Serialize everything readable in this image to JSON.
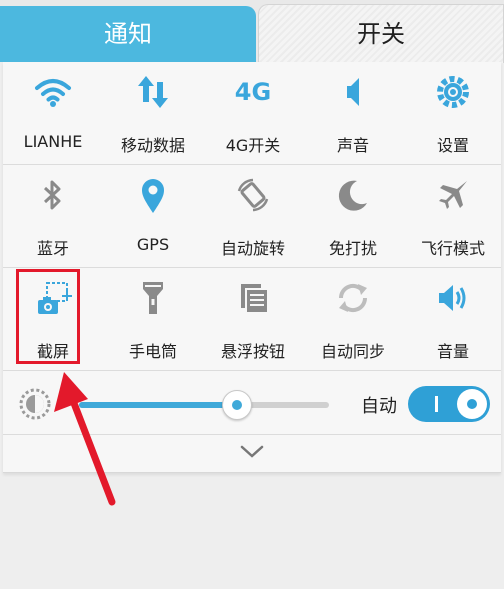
{
  "tabs": {
    "notifications": "通知",
    "switches": "开关"
  },
  "tiles": {
    "row1": [
      {
        "label": "LIANHE",
        "icon": "wifi-icon"
      },
      {
        "label": "移动数据",
        "icon": "mobile-data-icon"
      },
      {
        "label": "4G开关",
        "icon": "4g-icon",
        "icon_text": "4G"
      },
      {
        "label": "声音",
        "icon": "speaker-icon"
      },
      {
        "label": "设置",
        "icon": "gear-icon"
      }
    ],
    "row2": [
      {
        "label": "蓝牙",
        "icon": "bluetooth-icon"
      },
      {
        "label": "GPS",
        "icon": "location-pin-icon"
      },
      {
        "label": "自动旋转",
        "icon": "auto-rotate-icon"
      },
      {
        "label": "免打扰",
        "icon": "moon-icon"
      },
      {
        "label": "飞行模式",
        "icon": "airplane-icon"
      }
    ],
    "row3": [
      {
        "label": "截屏",
        "icon": "screenshot-icon"
      },
      {
        "label": "手电筒",
        "icon": "flashlight-icon"
      },
      {
        "label": "悬浮按钮",
        "icon": "floating-button-icon"
      },
      {
        "label": "自动同步",
        "icon": "sync-icon"
      },
      {
        "label": "音量",
        "icon": "volume-icon"
      }
    ]
  },
  "brightness": {
    "auto_label": "自动",
    "level": 0.62,
    "auto_enabled": true
  },
  "colors": {
    "accent": "#3fa9d9",
    "active_tab": "#4cb8df",
    "annotation": "#e3192b"
  }
}
